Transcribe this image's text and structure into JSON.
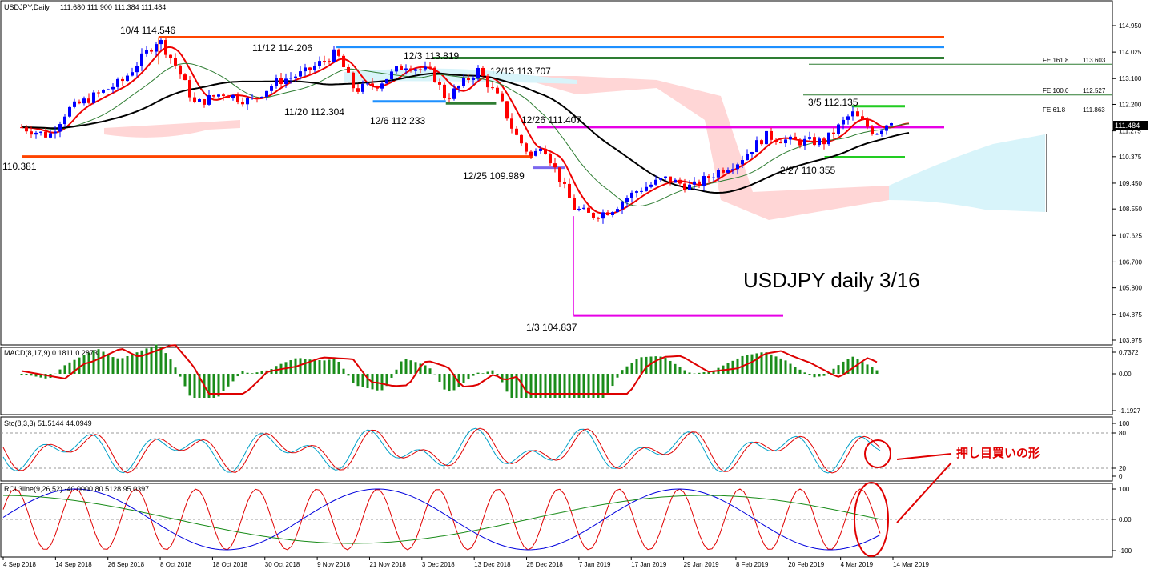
{
  "header": {
    "symbol": "USDJPY,Daily",
    "ohlc": "111.680 111.900 111.384 111.484"
  },
  "price_axis": {
    "ticks": [
      "114.950",
      "114.025",
      "113.100",
      "112.200",
      "111.275",
      "110.375",
      "109.450",
      "108.550",
      "107.625",
      "106.700",
      "105.800",
      "104.875",
      "103.975"
    ],
    "current": "111.484"
  },
  "time_axis": [
    "4 Sep 2018",
    "14 Sep 2018",
    "26 Sep 2018",
    "8 Oct 2018",
    "18 Oct 2018",
    "30 Oct 2018",
    "9 Nov 2018",
    "21 Nov 2018",
    "3 Dec 2018",
    "13 Dec 2018",
    "25 Dec 2018",
    "7 Jan 2019",
    "17 Jan 2019",
    "29 Jan 2019",
    "8 Feb 2019",
    "20 Feb 2019",
    "4 Mar 2019",
    "14 Mar 2019"
  ],
  "annotations": {
    "a1": "10/4 114.546",
    "a2": "11/12 114.206",
    "a3": "12/3 113.819",
    "a4": "12/13 113.707",
    "a5": "11/20 112.304",
    "a6": "12/6 112.233",
    "a7": "12/26 111.407",
    "a8": "110.381",
    "a9": "12/25 109.989",
    "a10": "3/5 112.135",
    "a11": "2/27 110.355",
    "a12": "1/3 104.837",
    "title": "USDJPY daily 3/16",
    "fe1": "FE 161.8",
    "fe1v": "113.603",
    "fe2": "FE 100.0",
    "fe2v": "112.527",
    "fe3": "FE 61.8",
    "fe3v": "111.863",
    "jp": "押し目買いの形"
  },
  "macd": {
    "label": "MACD(8,17,9) 0.1811 0.2873",
    "ticks": [
      "0.7372",
      "0.00",
      "-1.1927"
    ]
  },
  "sto": {
    "label": "Sto(8,3,3) 51.5144 44.0949",
    "ticks": [
      "100",
      "80",
      "20",
      "0"
    ]
  },
  "rci": {
    "label": "RCI 3line(9,26,52) -40.0000 80.5128 95.0397",
    "ticks": [
      "100",
      "0.00",
      "-100"
    ]
  },
  "chart_data": {
    "type": "candlestick",
    "symbol": "USDJPY",
    "timeframe": "Daily",
    "y_range": [
      103.9,
      115.3
    ],
    "close_path": [
      [
        "2018-09-04",
        111.4
      ],
      [
        "2018-09-10",
        111.1
      ],
      [
        "2018-09-14",
        112.0
      ],
      [
        "2018-09-20",
        112.5
      ],
      [
        "2018-09-26",
        113.0
      ],
      [
        "2018-10-04",
        114.5
      ],
      [
        "2018-10-08",
        113.5
      ],
      [
        "2018-10-12",
        112.2
      ],
      [
        "2018-10-18",
        112.6
      ],
      [
        "2018-10-24",
        112.3
      ],
      [
        "2018-10-30",
        113.0
      ],
      [
        "2018-11-05",
        113.3
      ],
      [
        "2018-11-12",
        114.0
      ],
      [
        "2018-11-16",
        112.7
      ],
      [
        "2018-11-21",
        112.9
      ],
      [
        "2018-11-27",
        113.6
      ],
      [
        "2018-12-03",
        113.3
      ],
      [
        "2018-12-06",
        112.4
      ],
      [
        "2018-12-13",
        113.4
      ],
      [
        "2018-12-18",
        112.3
      ],
      [
        "2018-12-21",
        111.2
      ],
      [
        "2018-12-25",
        110.3
      ],
      [
        "2018-12-27",
        110.9
      ],
      [
        "2019-01-03",
        108.6
      ],
      [
        "2019-01-07",
        108.3
      ],
      [
        "2019-01-11",
        108.5
      ],
      [
        "2019-01-17",
        109.2
      ],
      [
        "2019-01-23",
        109.6
      ],
      [
        "2019-01-29",
        109.3
      ],
      [
        "2019-02-04",
        109.9
      ],
      [
        "2019-02-08",
        110.2
      ],
      [
        "2019-02-14",
        111.1
      ],
      [
        "2019-02-20",
        110.9
      ],
      [
        "2019-02-27",
        110.9
      ],
      [
        "2019-03-05",
        111.9
      ],
      [
        "2019-03-10",
        111.2
      ],
      [
        "2019-03-14",
        111.7
      ],
      [
        "2019-03-15",
        111.48
      ]
    ],
    "levels": [
      {
        "price": 114.546,
        "color": "#ff4400"
      },
      {
        "price": 114.206,
        "color": "#1e90ff"
      },
      {
        "price": 113.819,
        "color": "#2e7d32"
      },
      {
        "price": 112.304,
        "color": "#1e90ff"
      },
      {
        "price": 112.233,
        "color": "#2e7d32"
      },
      {
        "price": 111.407,
        "color": "#e600e6"
      },
      {
        "price": 110.381,
        "color": "#ff4400"
      },
      {
        "price": 104.837,
        "color": "#e600e6"
      }
    ]
  }
}
